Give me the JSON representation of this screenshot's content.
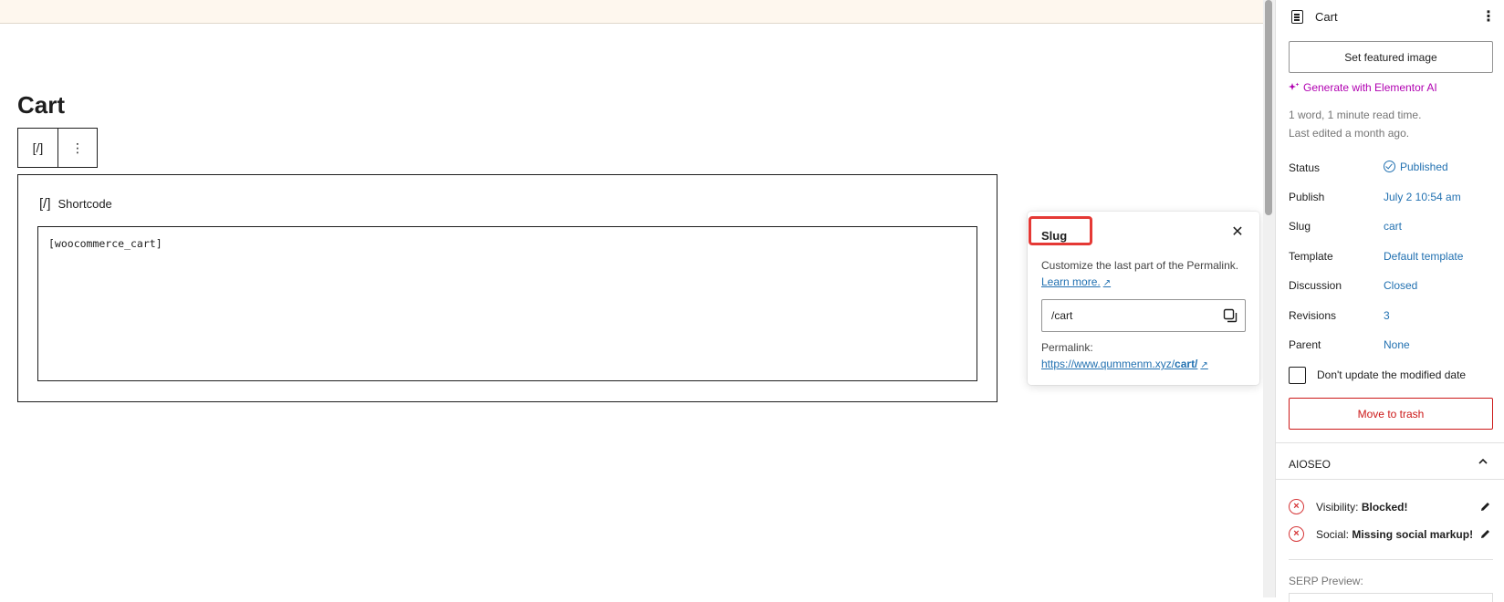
{
  "editor": {
    "page_title": "Cart",
    "toolbar": {
      "shortcode_icon": "[/]",
      "more_icon": "⋮"
    },
    "block": {
      "label": "Shortcode",
      "icon": "[/]",
      "content": "[woocommerce_cart]"
    }
  },
  "slug_popover": {
    "title": "Slug",
    "close": "✕",
    "description": "Customize the last part of the Permalink.",
    "learn_more": "Learn more.",
    "external_arrow": "↗",
    "slug_value": "/cart",
    "permalink_label": "Permalink:",
    "permalink_base": "https://www.qummenm.xyz/",
    "permalink_slug": "cart/"
  },
  "sidebar": {
    "title": "Cart",
    "more": "⋮",
    "featured_image": "Set featured image",
    "elementor_ai": "Generate with Elementor AI",
    "word_count": "1 word, 1 minute read time.",
    "last_edited": "Last edited a month ago.",
    "rows": [
      {
        "label": "Status",
        "value": "Published"
      },
      {
        "label": "Publish",
        "value": "July 2 10:54 am"
      },
      {
        "label": "Slug",
        "value": "cart"
      },
      {
        "label": "Template",
        "value": "Default template"
      },
      {
        "label": "Discussion",
        "value": "Closed"
      },
      {
        "label": "Revisions",
        "value": "3"
      },
      {
        "label": "Parent",
        "value": "None"
      }
    ],
    "modified_date_checkbox": "Don't update the modified date",
    "trash": "Move to trash",
    "aioseo": {
      "title": "AIOSEO",
      "visibility_label": "Visibility:",
      "visibility_value": "Blocked!",
      "social_label": "Social:",
      "social_value": "Missing social markup!",
      "serp_label": "SERP Preview:"
    }
  },
  "colors": {
    "accent_blue": "#2271b1",
    "highlight_red": "#e53935",
    "danger_red": "#cc1818",
    "elementor_magenta": "#b100b1"
  }
}
